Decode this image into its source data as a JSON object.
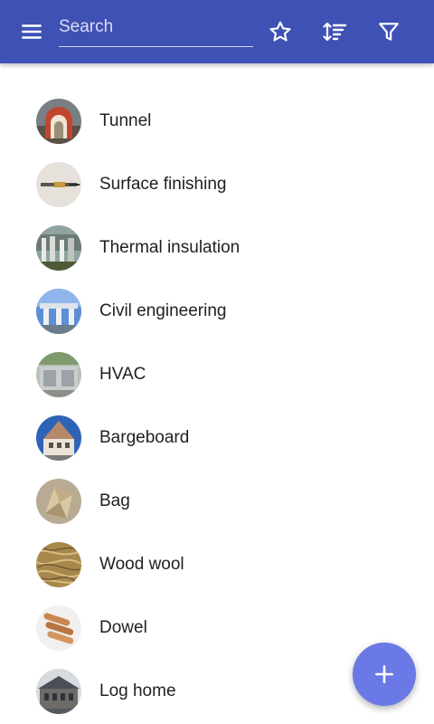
{
  "appbar": {
    "background": "#3f51b5",
    "menu_icon": "menu-icon",
    "search": {
      "placeholder": "Search",
      "value": ""
    },
    "actions": [
      {
        "icon": "star-outline-icon",
        "name": "favorites"
      },
      {
        "icon": "sort-icon",
        "name": "sort"
      },
      {
        "icon": "filter-icon",
        "name": "filter"
      }
    ]
  },
  "items": [
    {
      "label": "Tunnel",
      "thumbnail": "tunnel-photo"
    },
    {
      "label": "Surface finishing",
      "thumbnail": "surface-finishing-photo"
    },
    {
      "label": "Thermal insulation",
      "thumbnail": "thermal-insulation-photo"
    },
    {
      "label": "Civil engineering",
      "thumbnail": "civil-engineering-photo"
    },
    {
      "label": "HVAC",
      "thumbnail": "hvac-photo"
    },
    {
      "label": "Bargeboard",
      "thumbnail": "bargeboard-photo"
    },
    {
      "label": "Bag",
      "thumbnail": "bag-photo"
    },
    {
      "label": "Wood wool",
      "thumbnail": "wood-wool-photo"
    },
    {
      "label": "Dowel",
      "thumbnail": "dowel-photo"
    },
    {
      "label": "Log home",
      "thumbnail": "log-home-photo"
    }
  ],
  "fab": {
    "icon": "plus-icon",
    "color": "#6b79e6"
  }
}
